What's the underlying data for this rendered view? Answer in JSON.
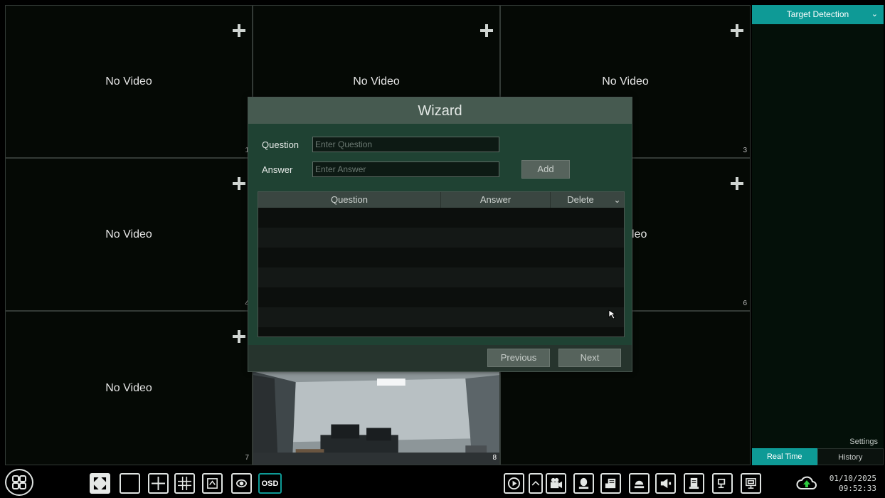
{
  "grid": {
    "cells": [
      {
        "label": "No Video",
        "num": "1"
      },
      {
        "label": "No Video",
        "num": ""
      },
      {
        "label": "No Video",
        "num": "3"
      },
      {
        "label": "No Video",
        "num": "4"
      },
      {
        "label": "No Video",
        "num": "6"
      },
      {
        "label": "No Video",
        "num": "7"
      },
      {
        "label": "",
        "num": "8"
      }
    ],
    "partial_label": "leo"
  },
  "panel": {
    "title": "Target Detection",
    "settings": "Settings",
    "tab_realtime": "Real Time",
    "tab_history": "History",
    "accent": "#0e9a96"
  },
  "wizard": {
    "title": "Wizard",
    "question_label": "Question",
    "answer_label": "Answer",
    "question_placeholder": "Enter Question",
    "answer_placeholder": "Enter Answer",
    "add_label": "Add",
    "col_question": "Question",
    "col_answer": "Answer",
    "col_delete": "Delete",
    "previous_label": "Previous",
    "next_label": "Next"
  },
  "toolbar": {
    "osd_label": "OSD",
    "icons": [
      "menu-grid-icon",
      "fullscreen-icon",
      "layout-1-icon",
      "layout-4-icon",
      "layout-9-icon",
      "layout-custom-icon",
      "sequence-icon",
      "osd-icon",
      "playback-icon",
      "expand-up-icon",
      "camera-icon",
      "person-icon",
      "alarm-icon",
      "ptz-icon",
      "speaker-icon",
      "storage-icon",
      "network-icon",
      "monitor-icon",
      "cloud-upload-icon"
    ]
  },
  "clock": {
    "date": "01/10/2025",
    "time": "09:52:33"
  }
}
